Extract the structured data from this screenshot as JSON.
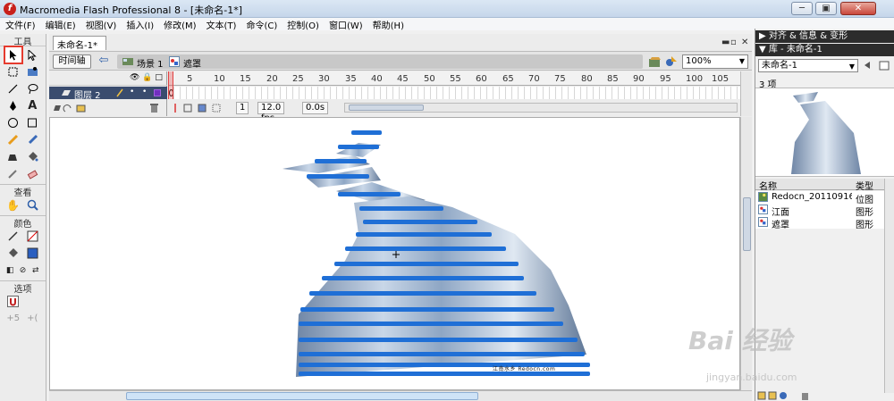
{
  "window": {
    "title": "Macromedia Flash Professional 8 - [未命名-1*]",
    "minimize": "─",
    "maximize": "▣",
    "close": "✕"
  },
  "menu": [
    "文件(F)",
    "编辑(E)",
    "视图(V)",
    "插入(I)",
    "修改(M)",
    "文本(T)",
    "命令(C)",
    "控制(O)",
    "窗口(W)",
    "帮助(H)"
  ],
  "toolbox": {
    "title": "工具",
    "view_label": "查看",
    "color_label": "颜色",
    "options_label": "选项"
  },
  "document": {
    "tab": "未命名-1*",
    "timeline_button": "时间轴",
    "scene_label": "场景 1",
    "symbol_label": "遮罩",
    "zoom": "100%",
    "layer_header_icons": "👁 🔒 □",
    "layer_name": "图层 2",
    "current_frame": "1",
    "fps": "12.0 fps",
    "elapsed": "0.0s",
    "frame_ticks": [
      "5",
      "10",
      "15",
      "20",
      "25",
      "30",
      "35",
      "40",
      "45",
      "50",
      "55",
      "60",
      "65",
      "70",
      "75",
      "80",
      "85",
      "90",
      "95",
      "100",
      "105"
    ]
  },
  "panel": {
    "align_header": "▶ 对齐 & 信息 & 变形",
    "library_header": "▼ 库 - 未命名-1",
    "library_select": "未命名-1",
    "item_count": "3 项",
    "col_name": "名称",
    "col_type": "类型",
    "items": [
      {
        "name": "Redocn_201109162...",
        "type": "位图"
      },
      {
        "name": "江面",
        "type": "图形"
      },
      {
        "name": "遮罩",
        "type": "图形"
      }
    ]
  },
  "stage": {
    "caption": "江南水乡 Redocn.com"
  },
  "watermark": {
    "brand": "Bai 经验",
    "url": "jingyan.baidu.com"
  },
  "colors": {
    "accent_red": "#e53b2e",
    "layer_highlight": "#3a4c6e",
    "stripe_blue": "#1f6fd6"
  }
}
